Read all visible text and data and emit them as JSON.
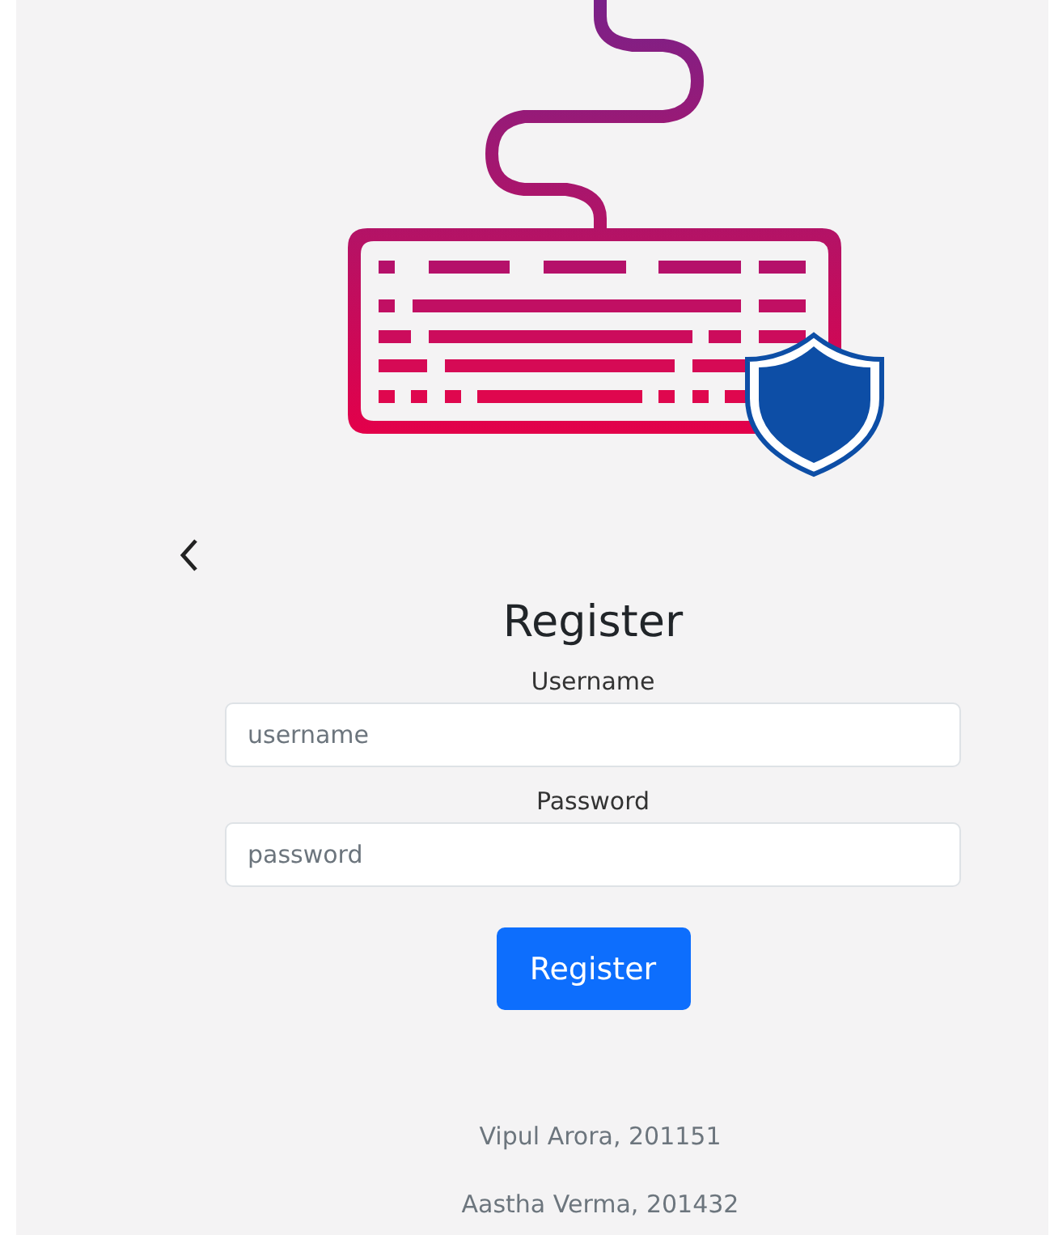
{
  "title": "Register",
  "fields": [
    {
      "label": "Username",
      "placeholder": "username"
    },
    {
      "label": "Password",
      "placeholder": "password"
    }
  ],
  "submit_button": {
    "label": "Register"
  },
  "credits": [
    "Vipul Arora, 201151",
    "Aastha Verma, 201432"
  ]
}
